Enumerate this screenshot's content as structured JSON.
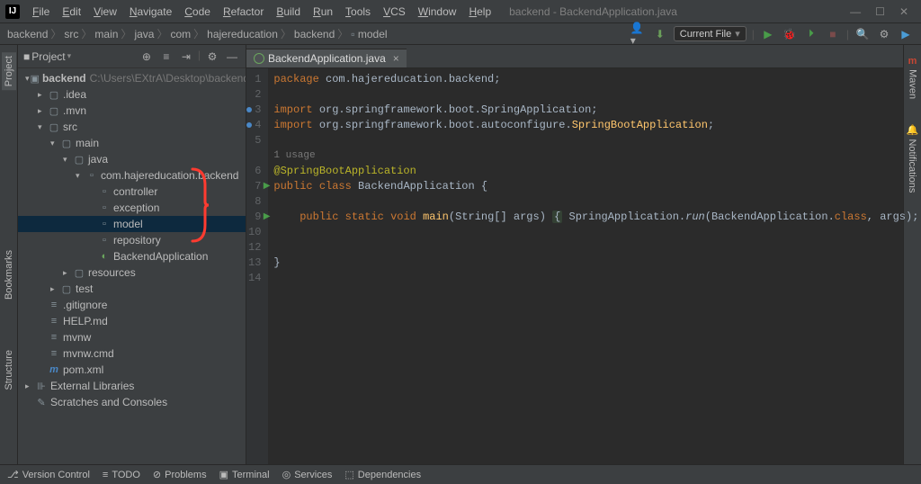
{
  "window": {
    "title": "backend - BackendApplication.java"
  },
  "menu": [
    "File",
    "Edit",
    "View",
    "Navigate",
    "Code",
    "Refactor",
    "Build",
    "Run",
    "Tools",
    "VCS",
    "Window",
    "Help"
  ],
  "breadcrumb": [
    "backend",
    "src",
    "main",
    "java",
    "com",
    "hajereducation",
    "backend",
    "model"
  ],
  "runconfig": "Current File",
  "sidebar": {
    "title": "Project",
    "project": {
      "name": "backend",
      "path": "C:\\Users\\EXtrA\\Desktop\\backend\\backend"
    },
    "tree": [
      {
        "d": 1,
        "exp": "open",
        "icon": "module",
        "label": "backend",
        "bold": true,
        "path": true
      },
      {
        "d": 2,
        "exp": "closed",
        "icon": "folder",
        "label": ".idea"
      },
      {
        "d": 2,
        "exp": "closed",
        "icon": "folder",
        "label": ".mvn"
      },
      {
        "d": 2,
        "exp": "open",
        "icon": "folder",
        "label": "src"
      },
      {
        "d": 3,
        "exp": "open",
        "icon": "folder",
        "label": "main"
      },
      {
        "d": 4,
        "exp": "open",
        "icon": "srcfolder",
        "label": "java"
      },
      {
        "d": 5,
        "exp": "open",
        "icon": "pkg",
        "label": "com.hajereducation.backend"
      },
      {
        "d": 6,
        "exp": "none",
        "icon": "pkg",
        "label": "controller"
      },
      {
        "d": 6,
        "exp": "none",
        "icon": "pkg",
        "label": "exception"
      },
      {
        "d": 6,
        "exp": "none",
        "icon": "pkg",
        "label": "model",
        "selected": true
      },
      {
        "d": 6,
        "exp": "none",
        "icon": "pkg",
        "label": "repository"
      },
      {
        "d": 6,
        "exp": "none",
        "icon": "class",
        "label": "BackendApplication"
      },
      {
        "d": 4,
        "exp": "closed",
        "icon": "folder",
        "label": "resources"
      },
      {
        "d": 3,
        "exp": "closed",
        "icon": "folder",
        "label": "test"
      },
      {
        "d": 2,
        "exp": "none",
        "icon": "file",
        "label": ".gitignore"
      },
      {
        "d": 2,
        "exp": "none",
        "icon": "file",
        "label": "HELP.md"
      },
      {
        "d": 2,
        "exp": "none",
        "icon": "file",
        "label": "mvnw"
      },
      {
        "d": 2,
        "exp": "none",
        "icon": "file",
        "label": "mvnw.cmd"
      },
      {
        "d": 2,
        "exp": "none",
        "icon": "mvn",
        "label": "pom.xml"
      },
      {
        "d": 1,
        "exp": "closed",
        "icon": "lib",
        "label": "External Libraries"
      },
      {
        "d": 1,
        "exp": "none",
        "icon": "scratch",
        "label": "Scratches and Consoles"
      }
    ]
  },
  "leftStrip": [
    "Project",
    "Bookmarks",
    "Structure"
  ],
  "rightStrip": [
    "Maven",
    "Notifications"
  ],
  "editor": {
    "tab": "BackendApplication.java",
    "usage": "1 usage",
    "lines": {
      "1": {
        "html": "<span class='kw'>package</span> <span class='pkg'>com.hajereducation.backend</span>;"
      },
      "2": {
        "html": ""
      },
      "3": {
        "html": "<span class='kw'>import</span> <span class='pkg'>org.springframework.boot.SpringApplication</span>;",
        "blue": true
      },
      "4": {
        "html": "<span class='kw'>import</span> <span class='pkg'>org.springframework.boot.autoconfigure.</span><span class='light'>SpringBootApplication</span>;",
        "blue": true
      },
      "5": {
        "html": ""
      },
      "6": {
        "html": "<span class='ann'>@SpringBootApplication</span>",
        "usageAbove": true
      },
      "7": {
        "html": "<span class='kw'>public</span> <span class='kw'>class</span> <span class='cls'>BackendApplication</span> {",
        "run": true
      },
      "8": {
        "html": ""
      },
      "9": {
        "html": "    <span class='kw'>public</span> <span class='kw'>static</span> <span class='kw'>void</span> <span class='light'>main</span>(String[] args) <span class='brk'>{</span> SpringApplication.<span style='font-style:italic'>run</span>(BackendApplication.<span class='kw'>class</span>, args); <span class='brk'>}</span>",
        "run": true
      },
      "10": {
        "html": ""
      },
      "12": {
        "html": ""
      },
      "13": {
        "html": "}"
      },
      "14": {
        "html": ""
      }
    },
    "lineOrder": [
      "1",
      "2",
      "3",
      "4",
      "5",
      "6",
      "7",
      "8",
      "9",
      "10",
      "12",
      "13",
      "14"
    ]
  },
  "statusbar": [
    "Version Control",
    "TODO",
    "Problems",
    "Terminal",
    "Services",
    "Dependencies"
  ]
}
